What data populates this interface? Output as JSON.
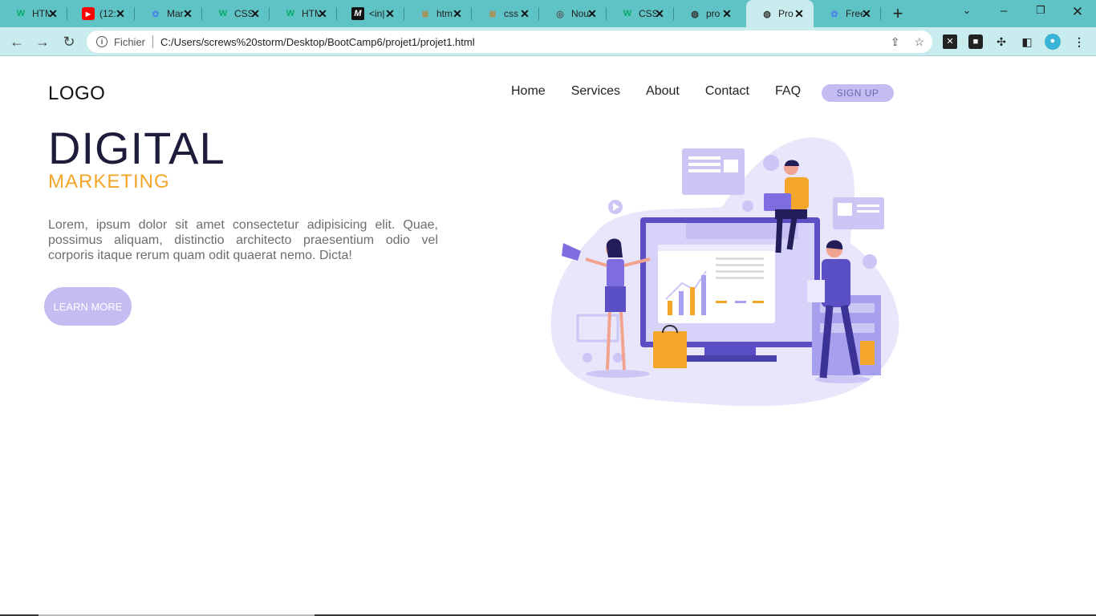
{
  "browser": {
    "tabs": [
      {
        "title": "HTM",
        "icon": "w3schools-icon",
        "color": "#04aa6d"
      },
      {
        "title": "(12:",
        "icon": "youtube-icon",
        "color": "#ff0000"
      },
      {
        "title": "Mar",
        "icon": "globe-blue-icon",
        "color": "#4a86e8"
      },
      {
        "title": "CSS",
        "icon": "w3schools-icon",
        "color": "#04aa6d"
      },
      {
        "title": "HTM",
        "icon": "w3schools-icon",
        "color": "#04aa6d"
      },
      {
        "title": "<in|",
        "icon": "mdn-icon",
        "color": "#000000"
      },
      {
        "title": "htm",
        "icon": "stackoverflow-icon",
        "color": "#b58a4a"
      },
      {
        "title": "css",
        "icon": "stackoverflow-icon",
        "color": "#b58a4a"
      },
      {
        "title": "Nou",
        "icon": "chrome-icon",
        "color": "#555555"
      },
      {
        "title": "CSS",
        "icon": "w3schools-icon",
        "color": "#04aa6d"
      },
      {
        "title": "pro",
        "icon": "globe-icon",
        "color": "#333333"
      },
      {
        "title": "Pro",
        "icon": "globe-icon",
        "color": "#333333",
        "active": true
      },
      {
        "title": "Free",
        "icon": "globe-blue-icon",
        "color": "#4a86e8"
      }
    ],
    "address": {
      "scheme_label": "Fichier",
      "url": "C:/Users/screws%20storm/Desktop/BootCamp6/projet1/projet1.html"
    }
  },
  "page": {
    "logo": "LOGO",
    "nav": [
      "Home",
      "Services",
      "About",
      "Contact",
      "FAQ"
    ],
    "signup": "SIGN UP",
    "title": "DIGITAL",
    "subtitle": "MARKETING",
    "body": "Lorem, ipsum dolor sit amet consectetur adipisicing elit. Quae, possimus aliquam, distinctio architecto praesentium odio vel corporis itaque rerum quam odit quaerat nemo. Dicta!",
    "cta": "LEARN MORE",
    "illustration": "digital-marketing-illustration"
  },
  "colors": {
    "accent": "#f4a62a",
    "lavender": "#c3bdf2",
    "dark": "#1d1c3a",
    "tabstrip": "#5fc3c5"
  }
}
